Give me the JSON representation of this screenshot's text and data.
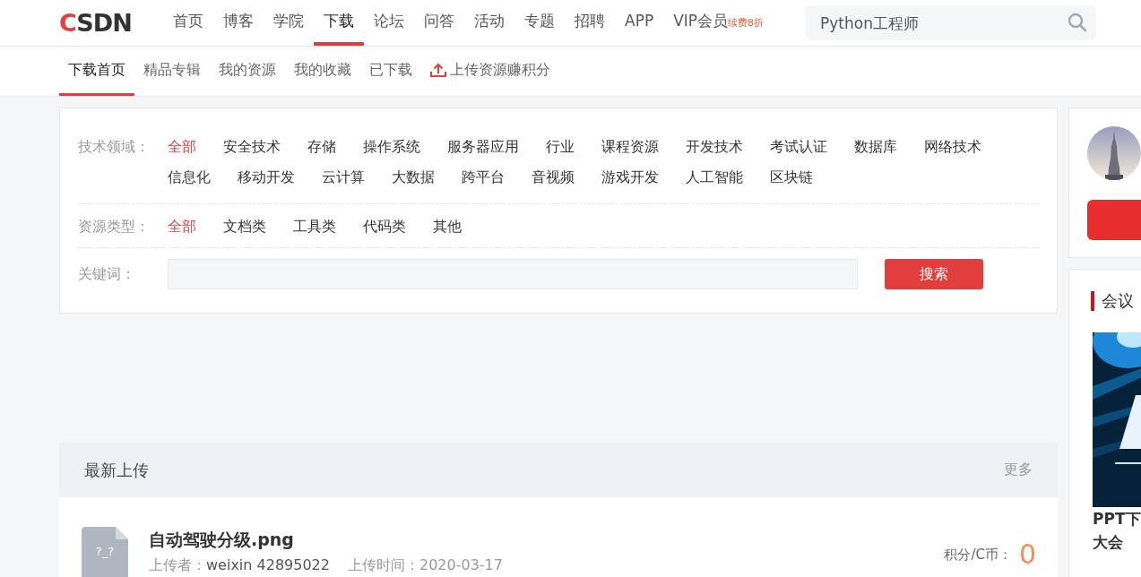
{
  "header": {
    "logo": "CSDN",
    "nav": [
      {
        "label": "首页",
        "selected": false
      },
      {
        "label": "博客",
        "selected": false
      },
      {
        "label": "学院",
        "selected": false
      },
      {
        "label": "下载",
        "selected": true
      },
      {
        "label": "论坛",
        "selected": false
      },
      {
        "label": "问答",
        "selected": false
      },
      {
        "label": "活动",
        "selected": false
      },
      {
        "label": "专题",
        "selected": false
      },
      {
        "label": "招聘",
        "selected": false
      },
      {
        "label": "APP",
        "selected": false
      },
      {
        "label": "VIP会员",
        "selected": false,
        "badge": "续费8折"
      }
    ],
    "search": {
      "placeholder": "Python工程师"
    }
  },
  "subnav": [
    {
      "label": "下载首页",
      "selected": true,
      "kind": "link"
    },
    {
      "label": "精品专辑",
      "selected": false,
      "kind": "link"
    },
    {
      "label": "我的资源",
      "selected": false,
      "kind": "link"
    },
    {
      "label": "我的收藏",
      "selected": false,
      "kind": "link"
    },
    {
      "label": "已下载",
      "selected": false,
      "kind": "link"
    },
    {
      "label": "上传资源赚积分",
      "selected": false,
      "kind": "upload"
    }
  ],
  "filters": [
    {
      "label": "技术领域：",
      "options": [
        {
          "label": "全部",
          "selected": true
        },
        {
          "label": "安全技术",
          "selected": false
        },
        {
          "label": "存储",
          "selected": false
        },
        {
          "label": "操作系统",
          "selected": false
        },
        {
          "label": "服务器应用",
          "selected": false
        },
        {
          "label": "行业",
          "selected": false
        },
        {
          "label": "课程资源",
          "selected": false
        },
        {
          "label": "开发技术",
          "selected": false
        },
        {
          "label": "考试认证",
          "selected": false
        },
        {
          "label": "数据库",
          "selected": false
        },
        {
          "label": "网络技术",
          "selected": false
        },
        {
          "label": "信息化",
          "selected": false
        },
        {
          "label": "移动开发",
          "selected": false
        },
        {
          "label": "云计算",
          "selected": false
        },
        {
          "label": "大数据",
          "selected": false
        },
        {
          "label": "跨平台",
          "selected": false
        },
        {
          "label": "音视频",
          "selected": false
        },
        {
          "label": "游戏开发",
          "selected": false
        },
        {
          "label": "人工智能",
          "selected": false
        },
        {
          "label": "区块链",
          "selected": false
        }
      ]
    },
    {
      "label": "资源类型：",
      "options": [
        {
          "label": "全部",
          "selected": true
        },
        {
          "label": "文档类",
          "selected": false
        },
        {
          "label": "工具类",
          "selected": false
        },
        {
          "label": "代码类",
          "selected": false
        },
        {
          "label": "其他",
          "selected": false
        }
      ]
    }
  ],
  "keyword": {
    "label": "关键词：",
    "button": "搜索"
  },
  "latest": {
    "title": "最新上传",
    "more": "更多",
    "items": [
      {
        "icon_text": "?_?",
        "title": "自动驾驶分级.png",
        "uploader_label": "上传者：",
        "uploader": "weixin 42895022",
        "time_label": "上传时间：",
        "time": "2020-03-17",
        "points_label": "积分/C币：",
        "points": "0"
      }
    ]
  },
  "sidebar": {
    "section_title": "会议",
    "card_title": [
      "PPT下",
      "大会"
    ]
  }
}
